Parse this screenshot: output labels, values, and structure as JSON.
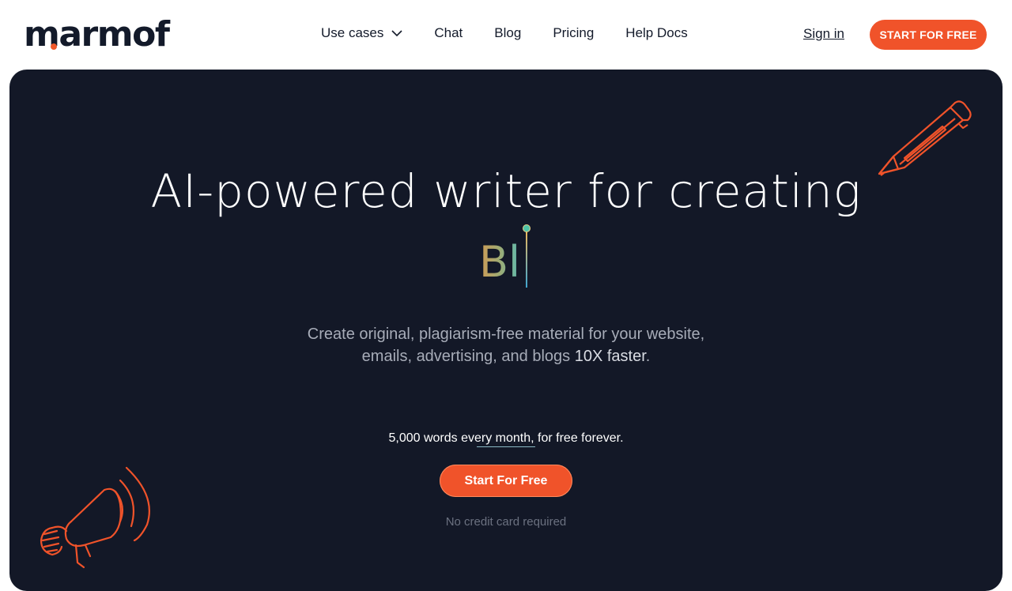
{
  "brand": {
    "name": "marmof",
    "accent": "#f0532a",
    "dark": "#131827"
  },
  "nav": {
    "items": [
      {
        "label": "Use cases",
        "has_dropdown": true
      },
      {
        "label": "Chat"
      },
      {
        "label": "Blog"
      },
      {
        "label": "Pricing"
      },
      {
        "label": "Help Docs"
      }
    ],
    "signin_label": "Sign in",
    "cta_label": "START FOR FREE"
  },
  "hero": {
    "headline": "AI-powered writer for creating",
    "typed_text": "Bl",
    "subtitle_line1": "Create original, plagiarism-free material for your website,",
    "subtitle_line2_prefix": "emails, advertising, and blogs ",
    "subtitle_line2_emphasis": "10X faster",
    "subtitle_line2_suffix": ".",
    "words_note": "5,000 words every month, for free forever.",
    "cta_label": "Start For Free",
    "no_card_note": "No credit card required"
  },
  "icons": {
    "pencil": "pencil-icon",
    "megaphone": "megaphone-icon",
    "chevron": "chevron-down-icon"
  }
}
